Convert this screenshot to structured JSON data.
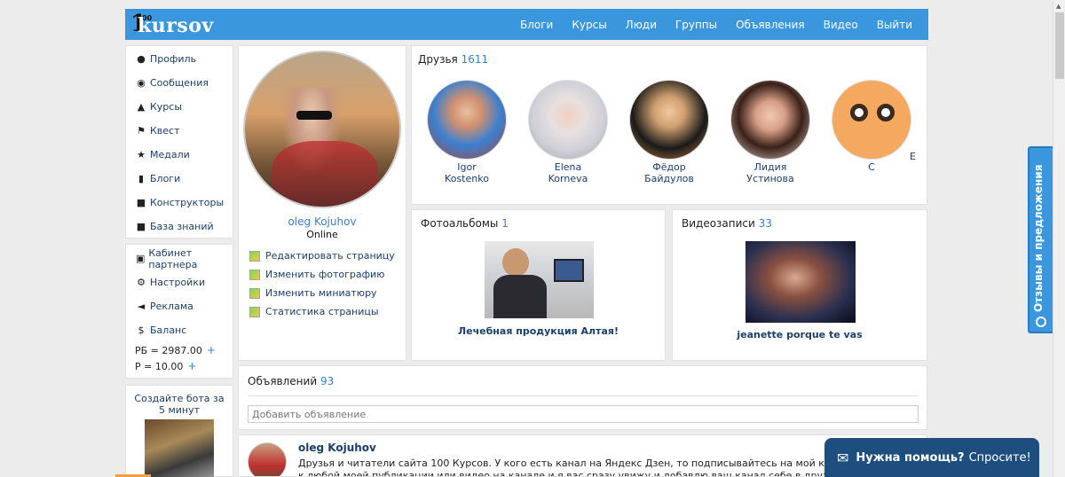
{
  "logo": {
    "top": "100",
    "word": "kursov"
  },
  "nav": [
    "Блоги",
    "Курсы",
    "Люди",
    "Группы",
    "Объявления",
    "Видео",
    "Выйти"
  ],
  "menu1": [
    {
      "label": "Профиль",
      "icon": "user-icon"
    },
    {
      "label": "Сообщения",
      "icon": "comments-icon"
    },
    {
      "label": "Курсы",
      "icon": "graduation-cap-icon"
    },
    {
      "label": "Квест",
      "icon": "flag-icon"
    },
    {
      "label": "Медали",
      "icon": "star-icon"
    },
    {
      "label": "Блоги",
      "icon": "microphone-icon"
    },
    {
      "label": "Конструкторы",
      "icon": "book-icon"
    },
    {
      "label": "База знаний",
      "icon": "book-icon"
    }
  ],
  "menu2": [
    {
      "label": "Кабинет партнера",
      "icon": "money-icon"
    },
    {
      "label": "Настройки",
      "icon": "gear-icon"
    },
    {
      "label": "Реклама",
      "icon": "bullhorn-icon"
    },
    {
      "label": "Баланс",
      "icon": "dollar-icon"
    }
  ],
  "balance": {
    "rb": "РБ = 2987.00",
    "p": "Р = 10.00",
    "plus": "+"
  },
  "promo": {
    "text": "Создайте бота за 5 минут"
  },
  "profile": {
    "name": "oleg Kojuhov",
    "status": "Online",
    "actions": [
      "Редактировать страницу",
      "Изменить фотографию",
      "Изменить миниатюру",
      "Статистика страницы"
    ]
  },
  "friends": {
    "title": "Друзья",
    "count": "1611",
    "items": [
      {
        "name1": "Igor",
        "name2": "Kostenko"
      },
      {
        "name1": "Elena",
        "name2": "Korneva"
      },
      {
        "name1": "Фёдор",
        "name2": "Байдулов"
      },
      {
        "name1": "Лидия",
        "name2": "Устинова"
      },
      {
        "name1": "С",
        "name2": ""
      }
    ],
    "extra": "E"
  },
  "albums": {
    "title": "Фотоальбомы",
    "count": "1",
    "caption": "Лечебная продукция Алтая!"
  },
  "videos": {
    "title": "Видеозаписи",
    "count": "33",
    "caption": "jeanette porque te vas"
  },
  "ads": {
    "title": "Объявлений",
    "count": "93",
    "placeholder": "Добавить объявление"
  },
  "post": {
    "author": "oleg Kojuhov",
    "line1": "Друзья и читатели сайта 100 Курсов. У кого есть канал на Яндекс Дзен, то подписывайтесь на мой канал и сразу нап",
    "line2": "к любой моей публикации или видео на канале и я вас сразу увижу и добавлю ваш канал себе в друзья. Вот мой кана"
  },
  "feedback_tab": "Отзывы и предложения",
  "help": {
    "q": "Нужна помощь?",
    "a": "Спросите!"
  },
  "colors": {
    "brand": "#3a96dd",
    "link": "#3a80c8",
    "help_bg": "#1d4e7e"
  }
}
